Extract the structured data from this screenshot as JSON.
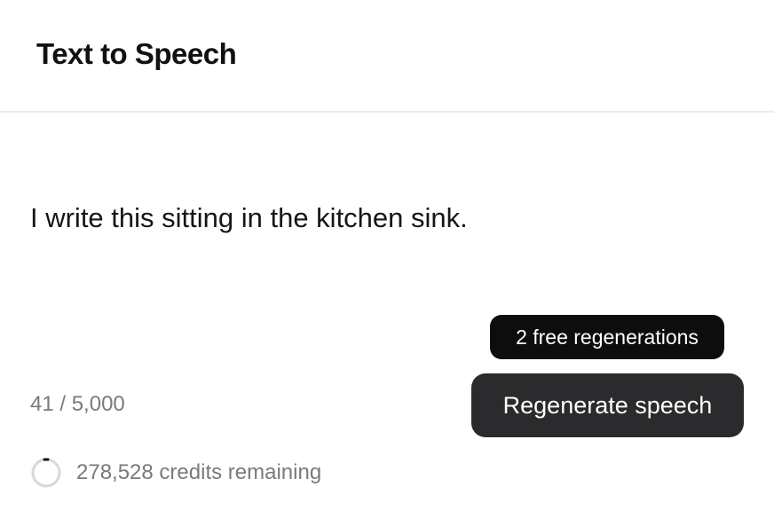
{
  "header": {
    "title": "Text to Speech"
  },
  "editor": {
    "text": "I write this sitting in the kitchen sink."
  },
  "footer": {
    "char_count": "41 / 5,000",
    "tooltip": "2 free regenerations",
    "regenerate_label": "Regenerate speech",
    "credits_text": "278,528 credits remaining",
    "credits_icon": "progress-ring-icon"
  },
  "colors": {
    "button_bg": "#2b2b2d",
    "tooltip_bg": "#0d0d0d",
    "muted_text": "#7a7a7a"
  }
}
